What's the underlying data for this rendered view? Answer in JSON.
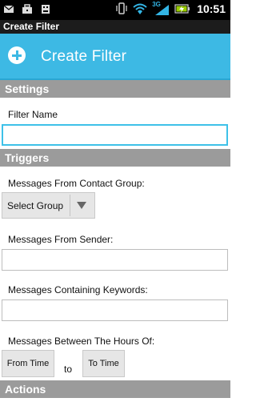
{
  "status_bar": {
    "time": "10:51",
    "network_label": "3G",
    "icons": [
      "mail-icon",
      "briefcase-icon",
      "android-icon",
      "vibrate-icon",
      "wifi-icon",
      "signal-icon",
      "battery-charging-icon"
    ]
  },
  "app": {
    "window_title": "Create Filter",
    "action_bar_title": "Create Filter",
    "accent_color": "#3db9e4"
  },
  "settings": {
    "header": "Settings",
    "filter_name_label": "Filter Name",
    "filter_name_value": ""
  },
  "triggers": {
    "header": "Triggers",
    "contact_group_label": "Messages From Contact Group:",
    "select_group_label": "Select Group",
    "sender_label": "Messages From Sender:",
    "sender_value": "",
    "keywords_label": "Messages Containing Keywords:",
    "keywords_value": "",
    "hours_label": "Messages Between The Hours Of:",
    "from_time_label": "From Time",
    "to_text": "to",
    "to_time_label": "To Time"
  },
  "actions": {
    "header": "Actions"
  }
}
